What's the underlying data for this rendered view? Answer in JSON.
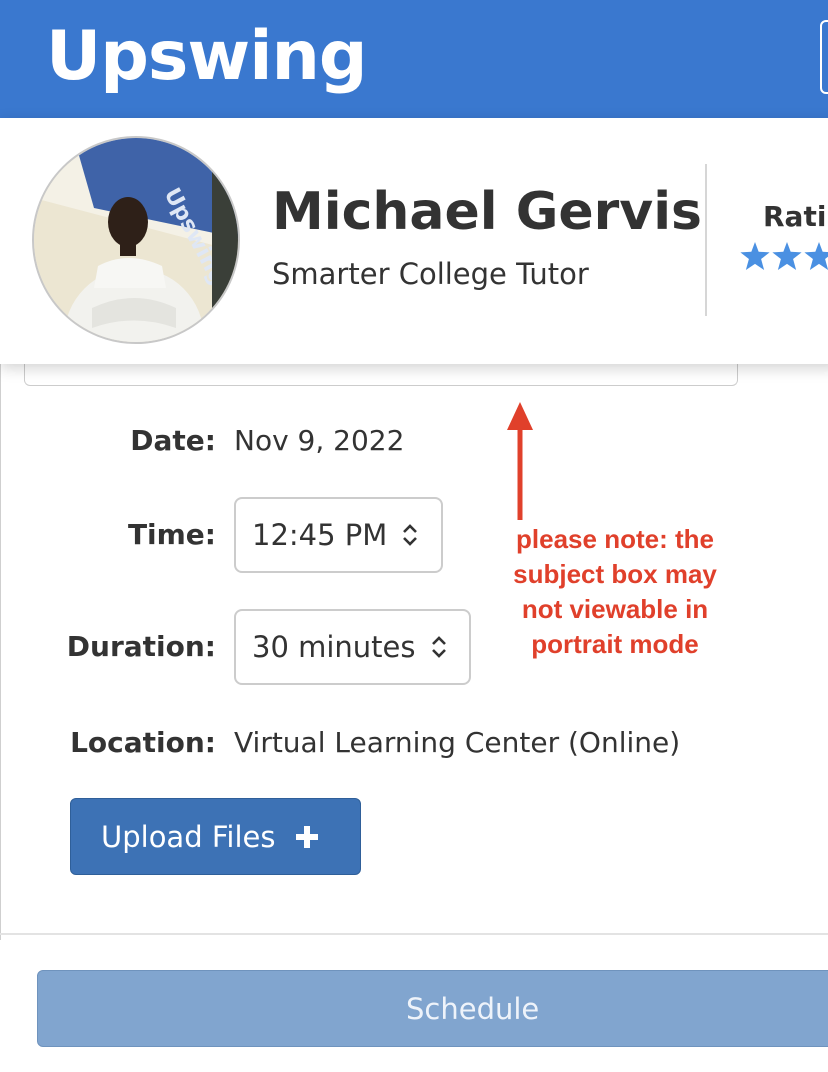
{
  "header": {
    "logo_text": "Upswing",
    "background_color": "#3a78cf"
  },
  "profile": {
    "name": "Michael Gervis",
    "title": "Smarter College Tutor",
    "rating_label": "Rati",
    "star_color": "#4a90e2",
    "visible_stars": 3,
    "avatar_icon": "tutor-photo"
  },
  "form": {
    "date_label": "Date:",
    "date_value": "Nov 9, 2022",
    "time_label": "Time:",
    "time_value": "12:45 PM",
    "duration_label": "Duration:",
    "duration_value": "30 minutes",
    "location_label": "Location:",
    "location_value": "Virtual Learning Center (Online)",
    "select_icon": "updown-chevron-icon"
  },
  "buttons": {
    "upload_label": "Upload Files",
    "upload_icon": "plus-icon",
    "upload_color": "#3d72b5",
    "schedule_label": "Schedule",
    "schedule_color": "#81a5cf"
  },
  "annotation": {
    "note": "please note: the subject box may not viewable in portrait mode",
    "color": "#e0402b",
    "icon": "arrow-up-icon"
  }
}
